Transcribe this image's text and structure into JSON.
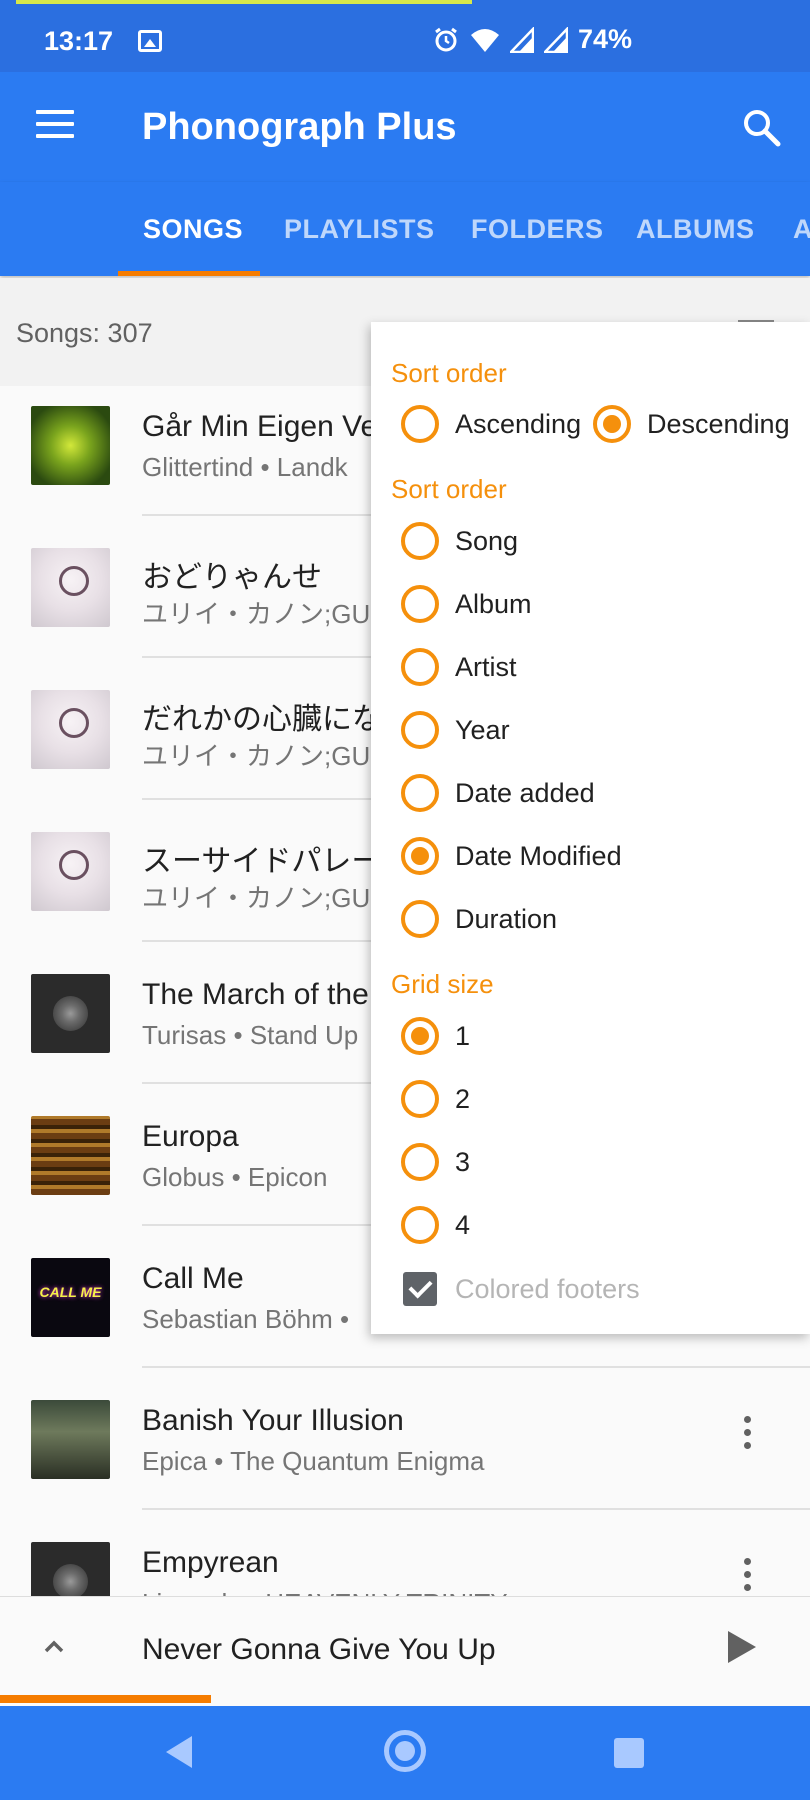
{
  "status": {
    "time": "13:17",
    "battery": "74%"
  },
  "toolbar": {
    "title": "Phonograph Plus"
  },
  "tabs": [
    "SONGS",
    "PLAYLISTS",
    "FOLDERS",
    "ALBUMS",
    "A"
  ],
  "songs_header": {
    "count_label": "Songs: 307"
  },
  "songs": [
    {
      "title": "Går Min Eigen Ve",
      "subtitle": "Glittertind • Landk",
      "art": "green"
    },
    {
      "title": "おどりゃんせ",
      "subtitle": "ユリイ・カノン;GU",
      "art": "tree"
    },
    {
      "title": "だれかの心臓にな",
      "subtitle": "ユリイ・カノン;GU",
      "art": "tree"
    },
    {
      "title": "スーサイドパレー",
      "subtitle": "ユリイ・カノン;GU",
      "art": "tree"
    },
    {
      "title": "The March of the",
      "subtitle": "Turisas • Stand Up",
      "art": "vinyl"
    },
    {
      "title": "Europa",
      "subtitle": "Globus • Epicon",
      "art": "europa"
    },
    {
      "title": "Call Me",
      "subtitle": "Sebastian Böhm •",
      "art": "callme",
      "art_text": "CALL ME"
    },
    {
      "title": "Banish Your Illusion",
      "subtitle": "Epica • The Quantum Enigma",
      "art": "epica"
    },
    {
      "title": "Empyrean",
      "subtitle": "Liamadu • HEAVENLY TRINITY",
      "art": "vinyl"
    }
  ],
  "mini_player": {
    "now_playing": "Never Gonna Give You Up",
    "progress": 0.26
  },
  "popup": {
    "order_title": "Sort order",
    "order_options": [
      {
        "label": "Ascending",
        "checked": false
      },
      {
        "label": "Descending",
        "checked": true
      }
    ],
    "sort_title": "Sort order",
    "sort_options": [
      {
        "label": "Song",
        "checked": false
      },
      {
        "label": "Album",
        "checked": false
      },
      {
        "label": "Artist",
        "checked": false
      },
      {
        "label": "Year",
        "checked": false
      },
      {
        "label": "Date added",
        "checked": false
      },
      {
        "label": "Date Modified",
        "checked": true
      },
      {
        "label": "Duration",
        "checked": false
      }
    ],
    "grid_title": "Grid size",
    "grid_options": [
      {
        "label": "1",
        "checked": true
      },
      {
        "label": "2",
        "checked": false
      },
      {
        "label": "3",
        "checked": false
      },
      {
        "label": "4",
        "checked": false
      }
    ],
    "colored_footers": {
      "label": "Colored footers",
      "checked": true
    }
  },
  "colors": {
    "primary": "#2b7bf2",
    "accent": "#f5900c",
    "indicator": "#f57c00"
  }
}
